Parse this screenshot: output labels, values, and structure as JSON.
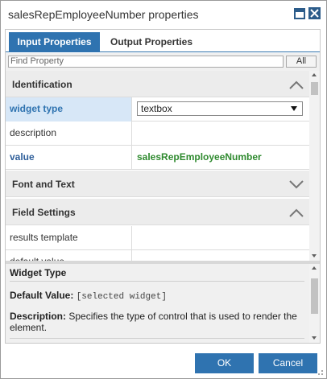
{
  "window": {
    "title": "salesRepEmployeeNumber properties"
  },
  "tabs": [
    {
      "label": "Input Properties",
      "active": true
    },
    {
      "label": "Output Properties",
      "active": false
    }
  ],
  "search": {
    "placeholder": "Find Property",
    "all_label": "All"
  },
  "sections": [
    {
      "label": "Identification",
      "expanded": true,
      "rows": [
        {
          "name": "widget type",
          "value": "textbox",
          "kind": "select",
          "highlighted": true
        },
        {
          "name": "description",
          "value": ""
        },
        {
          "name": "value",
          "value": "salesRepEmployeeNumber",
          "kind": "bold-green"
        }
      ]
    },
    {
      "label": "Font and Text",
      "expanded": false
    },
    {
      "label": "Field Settings",
      "expanded": true,
      "rows": [
        {
          "name": "results template",
          "value": ""
        },
        {
          "name": "default value",
          "value": ""
        }
      ]
    }
  ],
  "help": {
    "title": "Widget Type",
    "default_label": "Default Value:",
    "default_value": "[selected widget]",
    "description_label": "Description:",
    "description_text": "Specifies the type of control that is used to render the element."
  },
  "buttons": {
    "ok": "OK",
    "cancel": "Cancel"
  },
  "colors": {
    "accent": "#2f73b0",
    "value_green": "#2f8a2f"
  }
}
